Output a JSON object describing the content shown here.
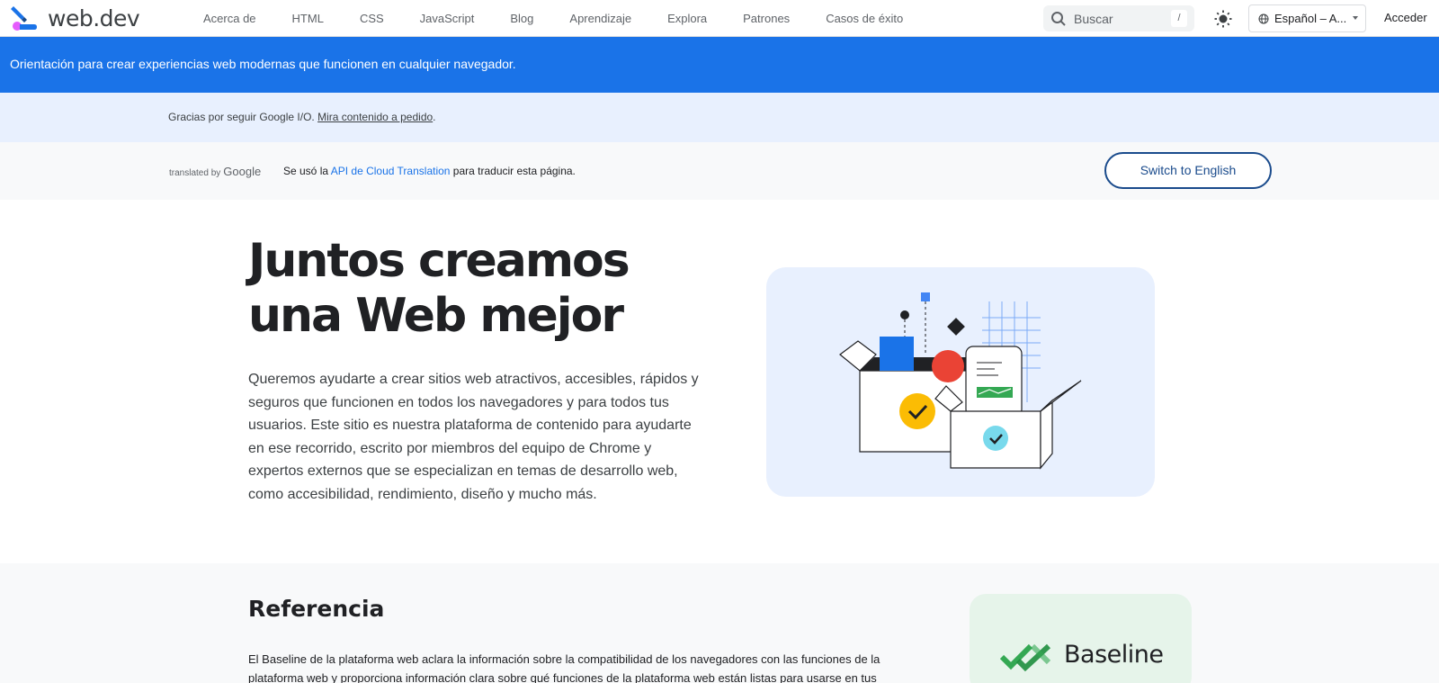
{
  "header": {
    "logo_text": "web.dev",
    "nav": [
      "Acerca de",
      "HTML",
      "CSS",
      "JavaScript",
      "Blog",
      "Aprendizaje",
      "Explora",
      "Patrones",
      "Casos de éxito"
    ],
    "search_placeholder": "Buscar",
    "search_shortcut": "/",
    "language": "Español – A...",
    "signin": "Acceder"
  },
  "banner": {
    "text": "Orientación para crear experiencias web modernas que funcionen en cualquier navegador."
  },
  "io_notice": {
    "text": "Gracias por seguir Google I/O. ",
    "link": "Mira contenido a pedido",
    "suffix": "."
  },
  "translation": {
    "translated_by": "translated by",
    "google": "Google",
    "prefix": "Se usó la ",
    "link": "API de Cloud Translation",
    "suffix": " para traducir esta página.",
    "switch_button": "Switch to English"
  },
  "hero": {
    "title_line1": "Juntos creamos",
    "title_line2": "una Web mejor",
    "description": "Queremos ayudarte a crear sitios web atractivos, accesibles, rápidos y seguros que funcionen en todos los navegadores y para todos tus usuarios. Este sitio es nuestra plataforma de contenido para ayudarte en ese recorrido, escrito por miembros del equipo de Chrome y expertos externos que se especializan en temas de desarrollo web, como accesibilidad, rendimiento, diseño y mucho más."
  },
  "reference": {
    "title": "Referencia",
    "text": "El Baseline de la plataforma web aclara la información sobre la compatibilidad de los navegadores con las funciones de la plataforma web y proporciona información clara sobre qué funciones de la plataforma web están listas para usarse en tus",
    "baseline_label": "Baseline"
  },
  "colors": {
    "brand_blue": "#1a73e8",
    "banner_bg": "#1a73e8",
    "io_bg": "#e8f0fe",
    "baseline_green": "#34a853"
  },
  "icons": [
    "web-dev-logo-icon",
    "search-icon",
    "theme-toggle-icon",
    "globe-icon",
    "chevron-down-icon",
    "baseline-check-icon"
  ]
}
